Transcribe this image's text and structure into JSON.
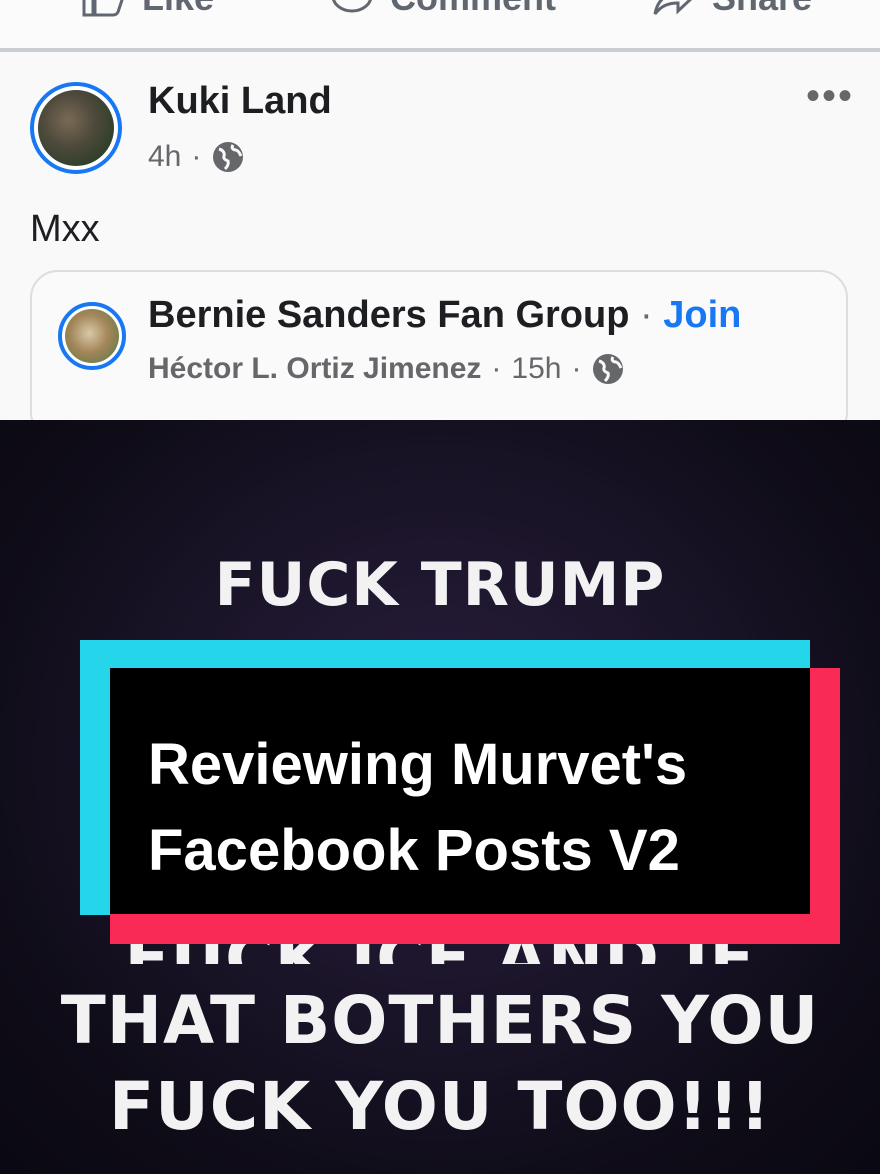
{
  "action_bar": {
    "like_label": "Like",
    "comment_label": "Comment",
    "share_label": "Share"
  },
  "post": {
    "author": "Kuki Land",
    "time": "4h",
    "separator": "·",
    "body": "Mxx",
    "more_label": "•••",
    "shared": {
      "group_name": "Bernie Sanders Fan Group",
      "separator": "·",
      "join_label": "Join",
      "poster": "Héctor L. Ortiz Jimenez",
      "time": "15h"
    }
  },
  "image": {
    "line1": "FUCK TRUMP",
    "line2": "FUCK ICE AND IF",
    "line3": "THAT BOTHERS YOU",
    "line4": "FUCK YOU TOO!!!"
  },
  "overlay": {
    "line1": "Reviewing Murvet's",
    "line2": "Facebook Posts V2"
  },
  "colors": {
    "facebook_blue": "#1877f2",
    "overlay_cyan": "#25d5ea",
    "overlay_red": "#f92a55",
    "overlay_black": "#000000"
  }
}
